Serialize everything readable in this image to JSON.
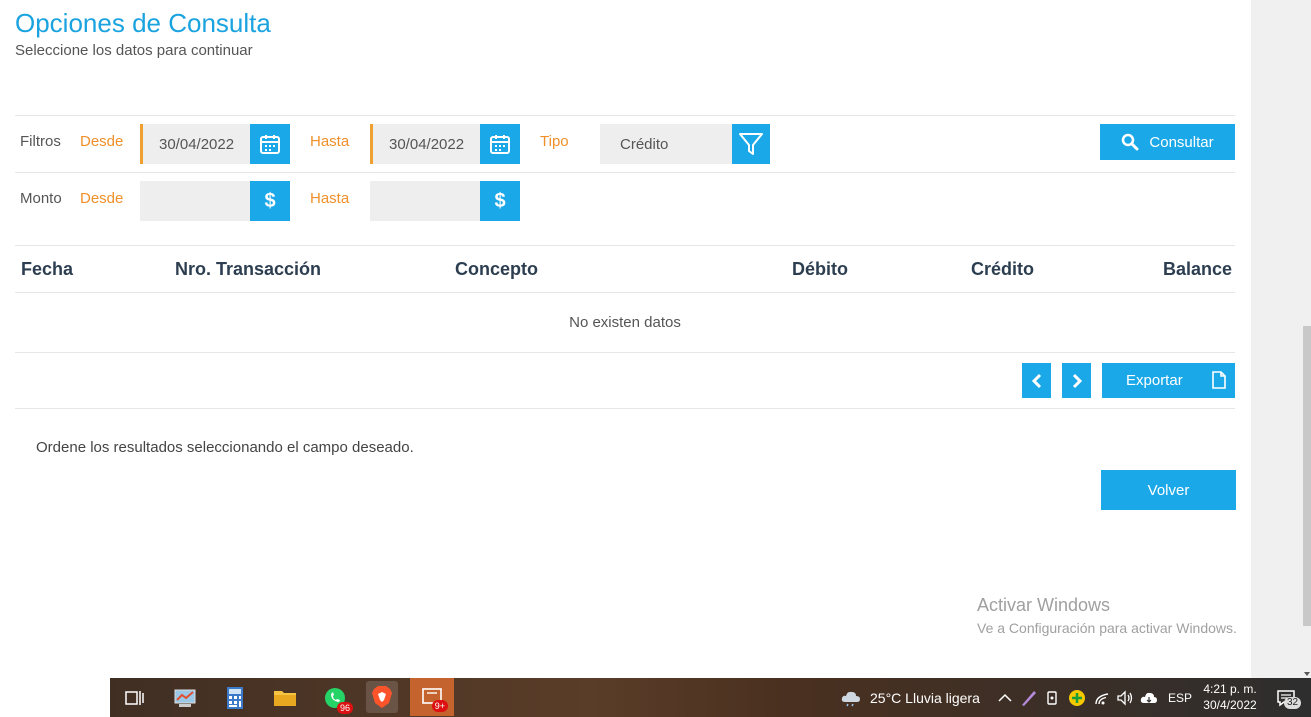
{
  "header": {
    "title": "Opciones de Consulta",
    "subtitle": "Seleccione los datos para continuar"
  },
  "filters": {
    "filtros_label": "Filtros",
    "desde_label": "Desde",
    "hasta_label": "Hasta",
    "tipo_label": "Tipo",
    "date_from": "30/04/2022",
    "date_to": "30/04/2022",
    "tipo_value": "Crédito",
    "consultar_label": "Consultar",
    "monto_label": "Monto",
    "monto_desde_label": "Desde",
    "monto_hasta_label": "Hasta",
    "monto_from": "",
    "monto_to": ""
  },
  "table": {
    "columns": [
      "Fecha",
      "Nro. Transacción",
      "Concepto",
      "Débito",
      "Crédito",
      "Balance"
    ],
    "empty_text": "No existen datos"
  },
  "pagination": {
    "export_label": "Exportar"
  },
  "footer": {
    "sort_note": "Ordene los resultados seleccionando el campo deseado.",
    "back_label": "Volver"
  },
  "watermark": {
    "line1": "Activar Windows",
    "line2": "Ve a Configuración para activar Windows."
  },
  "taskbar": {
    "whatsapp_badge": "96",
    "app_badge": "9+",
    "weather": "25°C  Lluvia ligera",
    "language": "ESP",
    "time": "4:21 p. m.",
    "date": "30/4/2022",
    "notifications": "32"
  },
  "colors": {
    "accent": "#1aa8e8",
    "orange": "#f0902a",
    "title": "#1aa3df"
  }
}
